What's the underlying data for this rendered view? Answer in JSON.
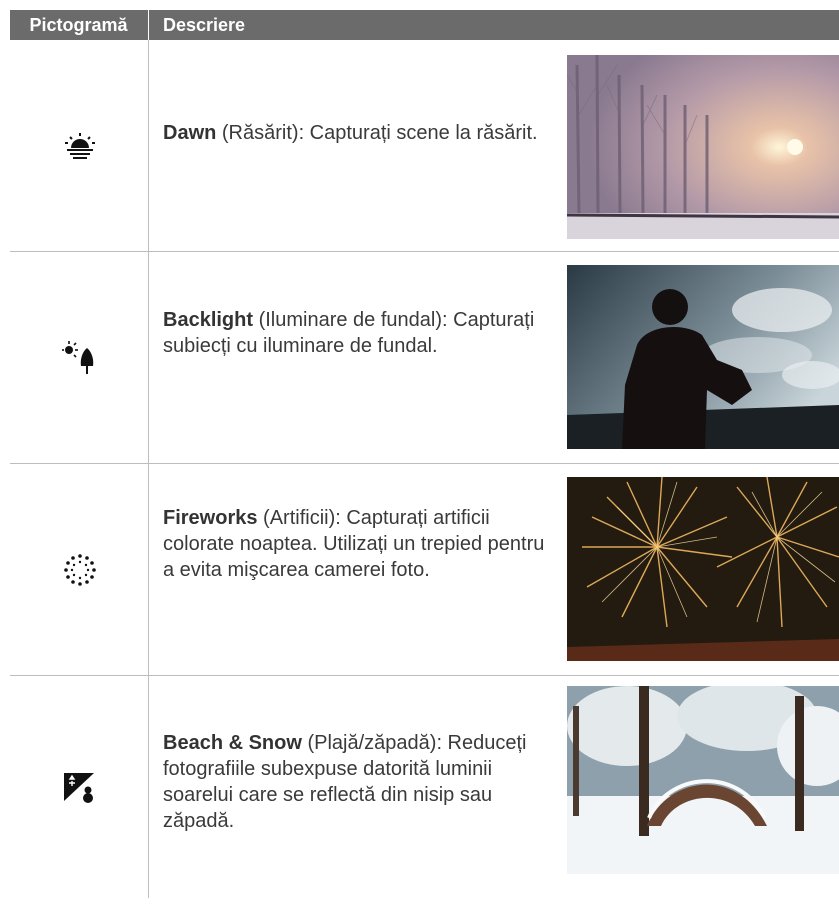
{
  "header": {
    "col1": "Pictogramă",
    "col2": "Descriere"
  },
  "rows": [
    {
      "icon": "dawn-icon",
      "title": "Dawn",
      "rest": " (Răsărit): Capturați scene la răsărit.",
      "photo": "misty-sunrise-trees-photo"
    },
    {
      "icon": "backlight-icon",
      "title": "Backlight",
      "rest": " (Iluminare de fundal): Capturați subiecți cu iluminare de fundal.",
      "photo": "silhouette-photographer-photo"
    },
    {
      "icon": "fireworks-icon",
      "title": "Fireworks",
      "rest": " (Artificii): Capturați artificii colorate noaptea. Utilizați un trepied pentru a evita mişcarea camerei foto.",
      "photo": "fireworks-photo"
    },
    {
      "icon": "beach-snow-icon",
      "title": "Beach & Snow",
      "rest": " (Plajă/zăpadă): Reduceți fotografiile subexpuse datorită luminii soarelui care se reflectă din nisip sau zăpadă.",
      "photo": "snowy-park-photo"
    }
  ]
}
